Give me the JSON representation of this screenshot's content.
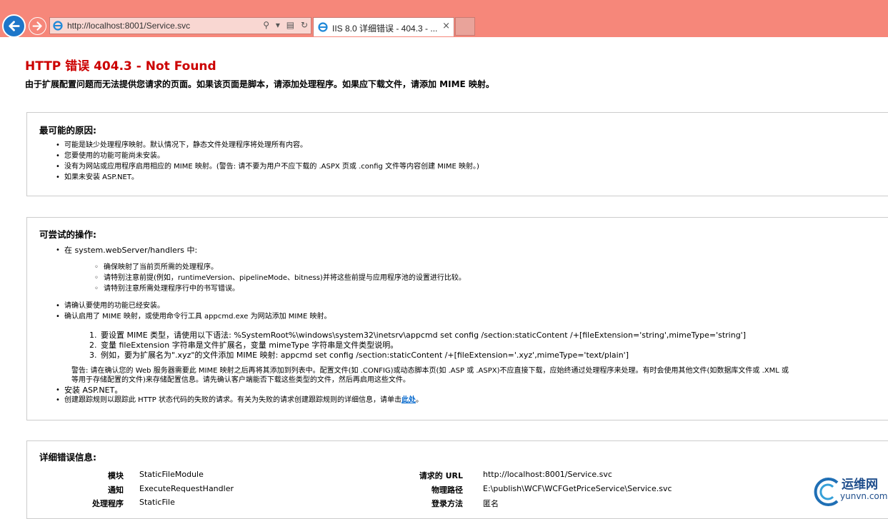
{
  "browser": {
    "address_url": "http://localhost:8001/Service.svc",
    "tab_title": "IIS 8.0 详细错误 - 404.3 - ...",
    "tab_close": "×",
    "accent_color": "#f6877a",
    "icons": [
      "back-arrow-icon",
      "forward-arrow-icon",
      "ie-logo-icon",
      "search-icon",
      "compat-view-icon",
      "refresh-icon",
      "close-icon"
    ]
  },
  "page": {
    "title": "HTTP 错误 404.3 - Not Found",
    "summary": "由于扩展配置问题而无法提供您请求的页面。如果该页面是脚本，请添加处理程序。如果应下载文件，请添加 MIME 映射。",
    "causes": {
      "heading": "最可能的原因:",
      "items": [
        "可能是缺少处理程序映射。默认情况下，静态文件处理程序将处理所有内容。",
        "您要使用的功能可能尚未安装。",
        "没有为网站或应用程序启用相应的 MIME 映射。(警告: 请不要为用户不应下载的 .ASPX 页或 .config 文件等内容创建 MIME 映射。)",
        "如果未安装 ASP.NET。"
      ]
    },
    "actions": {
      "heading": "可尝试的操作:",
      "item1": "在 system.webServer/handlers 中:",
      "sub_items": [
        "确保映射了当前页所需的处理程序。",
        "请特别注意前提(例如，runtimeVersion、pipelineMode、bitness)并将这些前提与应用程序池的设置进行比较。",
        "请特别注意所需处理程序行中的书写错误。"
      ],
      "item2": "请确认要使用的功能已经安装。",
      "item3": "确认启用了 MIME 映射，或使用命令行工具 appcmd.exe 为网站添加 MIME 映射。",
      "numbered": [
        {
          "n": "1.",
          "text": "要设置 MIME 类型，请使用以下语法: %SystemRoot%\\windows\\system32\\inetsrv\\appcmd set config /section:staticContent /+[fileExtension='string',mimeType='string']"
        },
        {
          "n": "2.",
          "text": "变量 fileExtension 字符串是文件扩展名，变量 mimeType 字符串是文件类型说明。"
        },
        {
          "n": "3.",
          "text": "例如，要为扩展名为\".xyz\"的文件添加 MIME 映射: appcmd set config /section:staticContent /+[fileExtension='.xyz',mimeType='text/plain']"
        }
      ],
      "warning_line1": "警告: 请在确认您的 Web 服务器需要此 MIME 映射之后再将其添加到列表中。配置文件(如 .CONFIG)或动态脚本页(如 .ASP 或 .ASPX)不应直接下载，应始终通过处理程序来处理。有时会使用其他文件(如数据库文件或 .XML 或",
      "warning_line2": "等用于存储配置的文件)来存储配置信息。请先确认客户端能否下载这些类型的文件，然后再启用这些文件。",
      "item4": "安装 ASP.NET。",
      "item5_text": "创建跟踪规则以跟踪此 HTTP 状态代码的失败的请求。有关为失败的请求创建跟踪规则的详细信息，请单击",
      "item5_link": "此处",
      "item5_end": "。"
    },
    "details": {
      "heading": "详细错误信息:",
      "rows_left": [
        {
          "label": "模块",
          "value": "StaticFileModule"
        },
        {
          "label": "通知",
          "value": "ExecuteRequestHandler"
        },
        {
          "label": "处理程序",
          "value": "StaticFile"
        }
      ],
      "rows_right": [
        {
          "label": "请求的 URL",
          "value": "http://localhost:8001/Service.svc"
        },
        {
          "label": "物理路径",
          "value": "E:\\publish\\WCF\\WCFGetPriceService\\Service.svc"
        },
        {
          "label": "登录方法",
          "value": "匿名"
        }
      ]
    }
  },
  "watermark": {
    "cn": "运维网",
    "en": "yunvn.com"
  }
}
